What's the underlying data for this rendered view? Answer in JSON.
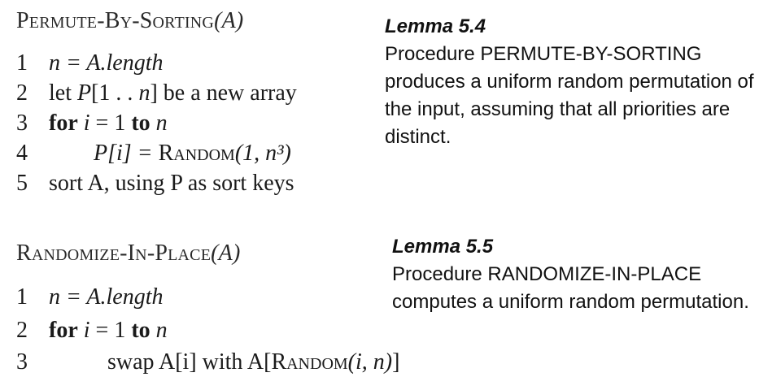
{
  "algorithms": [
    {
      "name": "Permute-By-Sorting",
      "arg": "(A)",
      "lines": [
        {
          "num": "1",
          "text": "n = A.length"
        },
        {
          "num": "2",
          "text_pre": "let ",
          "text_var": "P",
          "text_mid": "[1 . . ",
          "text_var2": "n",
          "text_post": "] be a new array"
        },
        {
          "num": "3",
          "kw1": "for",
          "var": " i",
          "mid": " = 1 ",
          "kw2": "to",
          "var2": " n"
        },
        {
          "num": "4",
          "lhs": "P[i] = ",
          "fn": "Random",
          "args": "(1, n³)"
        },
        {
          "num": "5",
          "text": "sort A, using P as sort keys"
        }
      ]
    },
    {
      "name": "Randomize-In-Place",
      "arg": "(A)",
      "lines": [
        {
          "num": "1",
          "text": "n = A.length"
        },
        {
          "num": "2",
          "kw1": "for",
          "var": " i",
          "mid": " = 1 ",
          "kw2": "to",
          "var2": " n"
        },
        {
          "num": "3",
          "pre": "swap A[i] with A[",
          "fn": "Random",
          "args": "(i, n)",
          "post": "]"
        }
      ]
    }
  ],
  "lemmas": [
    {
      "title": "Lemma 5.4",
      "text": "Procedure PERMUTE-BY-SORTING produces a uniform random permutation of the input, assuming that all priorities are distinct."
    },
    {
      "title": "Lemma 5.5",
      "text": "Procedure RANDOMIZE-IN-PLACE computes a uniform random permutation."
    }
  ]
}
